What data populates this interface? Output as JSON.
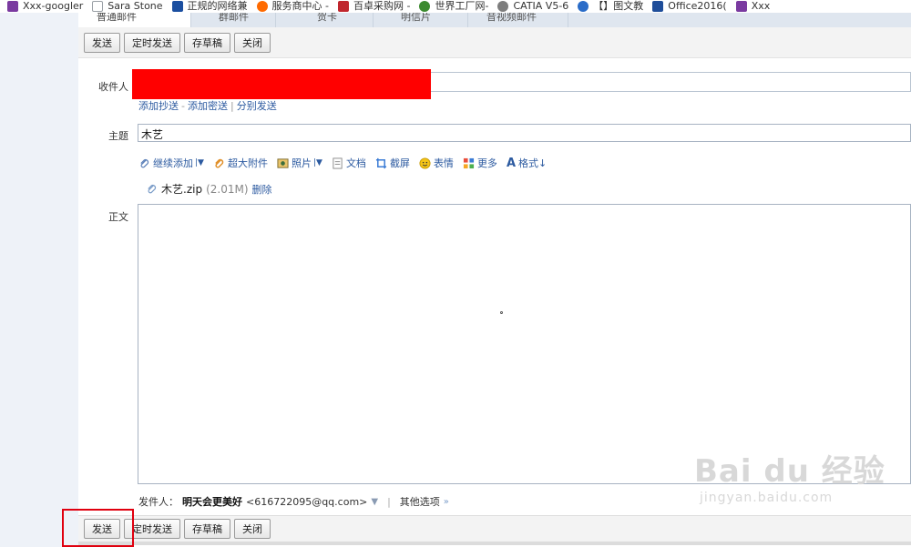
{
  "bookmarks": [
    {
      "label": "Xxx-googler",
      "color": "#7a3aa0"
    },
    {
      "label": "Sara Stone",
      "color": "#9aa0a6"
    },
    {
      "label": "正规的网络兼",
      "color": "#1b4fa0"
    },
    {
      "label": "服务商中心 -",
      "color": "#ff6a00"
    },
    {
      "label": "百卓采购网 -",
      "color": "#c0262d"
    },
    {
      "label": "世界工厂网-",
      "color": "#3b8a2f"
    },
    {
      "label": "CATIA V5-6",
      "color": "#7d7d7d"
    },
    {
      "label": "【】图文教",
      "color": "#2a6cc8"
    },
    {
      "label": "Office2016(",
      "color": "#1f4e9a"
    },
    {
      "label": "Xxx",
      "color": "#7a3aa0"
    }
  ],
  "tabs": [
    "普通邮件",
    "群邮件",
    "贺卡",
    "明信片",
    "音视频邮件"
  ],
  "toolbar": {
    "send": "发送",
    "scheduled_send": "定时发送",
    "save_draft": "存草稿",
    "close": "关闭"
  },
  "form": {
    "recipient_label": "收件人",
    "cc_links": [
      "添加抄送",
      "添加密送",
      "分别发送"
    ],
    "subject_label": "主题",
    "subject_value": "木艺",
    "body_label": "正文"
  },
  "attach_bar": [
    {
      "label": "继续添加",
      "icon": "paperclip-icon",
      "dropdown": true
    },
    {
      "label": "超大附件",
      "icon": "large-attachment-icon",
      "dropdown": false
    },
    {
      "label": "照片",
      "icon": "photo-icon",
      "dropdown": true
    },
    {
      "label": "文档",
      "icon": "document-icon",
      "dropdown": false
    },
    {
      "label": "截屏",
      "icon": "screenshot-icon",
      "dropdown": false
    },
    {
      "label": "表情",
      "icon": "emoji-icon",
      "dropdown": false
    },
    {
      "label": "更多",
      "icon": "more-icon",
      "dropdown": false
    },
    {
      "label": "格式",
      "icon": "format-icon",
      "dropdown": false
    }
  ],
  "attachment": {
    "filename": "木艺.zip",
    "size": "(2.01M)",
    "delete": "删除"
  },
  "sender": {
    "label": "发件人：",
    "name": "明天会更美好",
    "email": "<616722095@qq.com>",
    "other_options": "其他选项"
  },
  "watermark": {
    "brand": "Bai du 经验",
    "url": "jingyan.baidu.com"
  },
  "colors": {
    "link": "#2c5aa0",
    "highlight": "#e0000f",
    "redaction": "#ff0000"
  }
}
